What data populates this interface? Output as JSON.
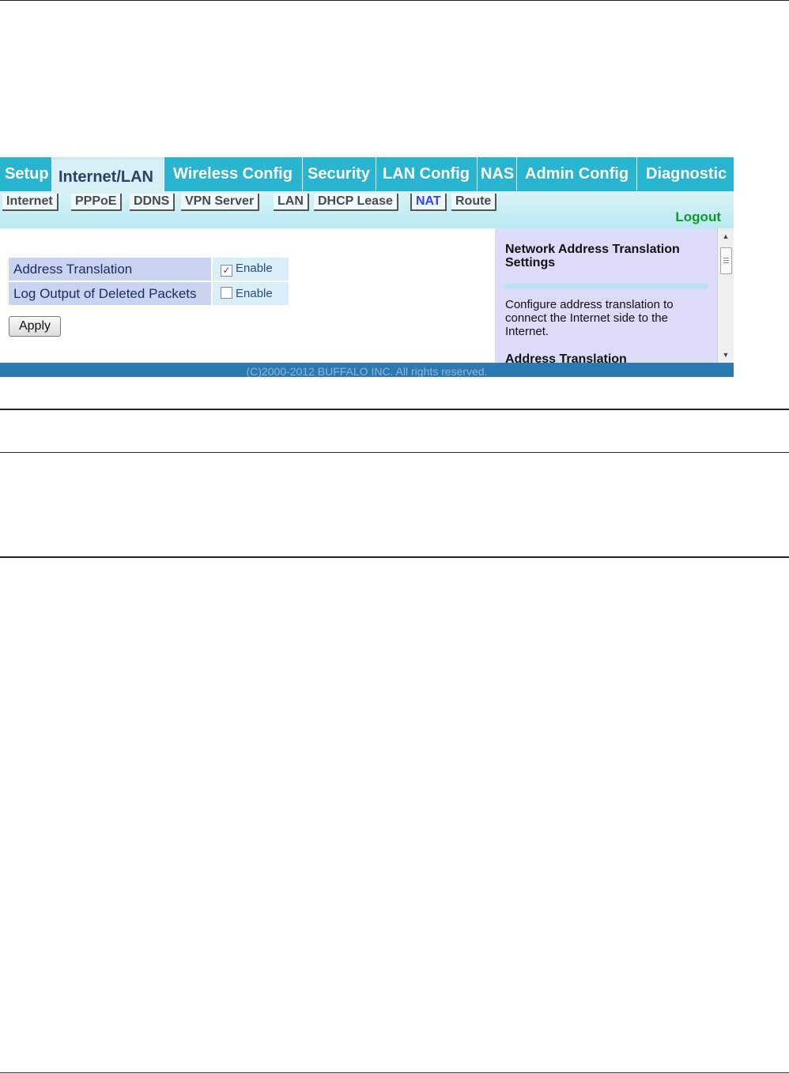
{
  "top_tabs": [
    "Setup",
    "Internet/LAN",
    "Wireless Config",
    "Security",
    "LAN Config",
    "NAS",
    "Admin Config",
    "Diagnostic"
  ],
  "sub_tabs": [
    "Internet",
    "PPPoE",
    "DDNS",
    "VPN Server",
    "LAN",
    "DHCP Lease",
    "NAT",
    "Route"
  ],
  "active_top_tab": "Internet/LAN",
  "active_sub_tab": "NAT",
  "logout_label": "Logout",
  "settings": {
    "address_translation": {
      "label": "Address Translation",
      "enable_label": "Enable",
      "checked": true
    },
    "log_output": {
      "label": "Log Output of Deleted Packets",
      "enable_label": "Enable",
      "checked": false
    }
  },
  "apply_label": "Apply",
  "help": {
    "title": "Network Address Translation Settings",
    "text": "Configure address translation to connect the Internet side to the Internet.",
    "subheading": "Address Translation"
  },
  "footer": "(C)2000-2012 BUFFALO INC. All rights reserved."
}
